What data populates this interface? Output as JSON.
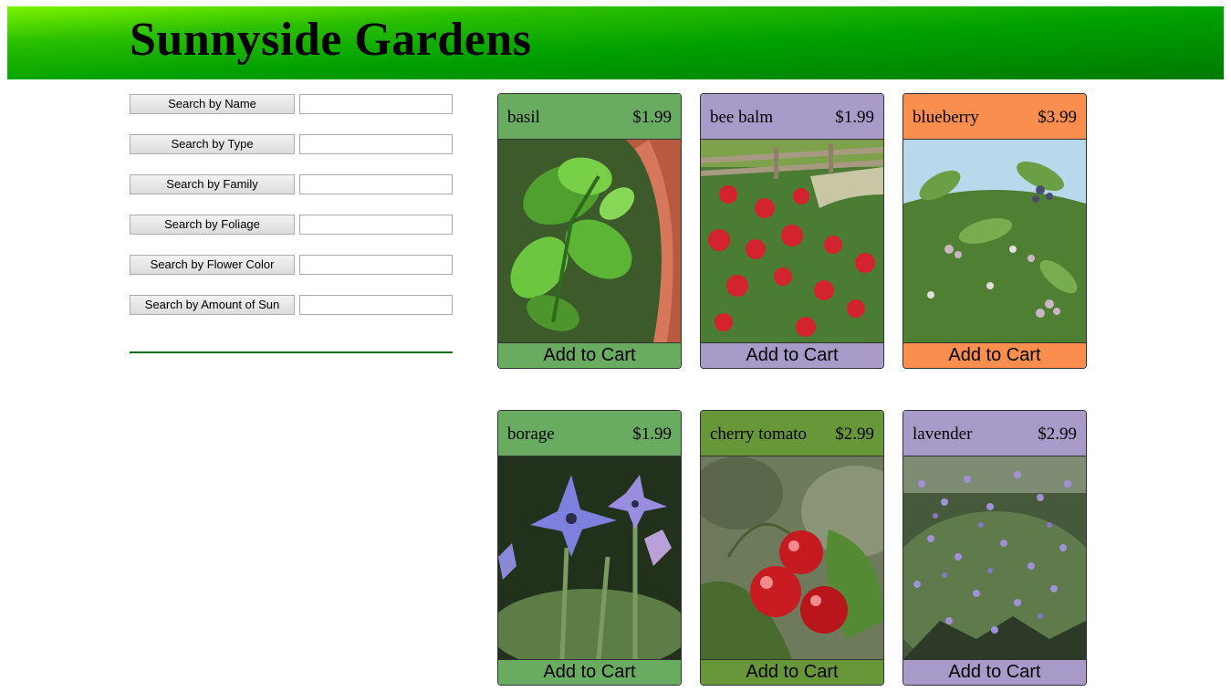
{
  "header": {
    "title": "Sunnyside Gardens"
  },
  "search": [
    {
      "label": "Search by Name",
      "value": ""
    },
    {
      "label": "Search by Type",
      "value": ""
    },
    {
      "label": "Search by Family",
      "value": ""
    },
    {
      "label": "Search by Foliage",
      "value": ""
    },
    {
      "label": "Search by Flower Color",
      "value": ""
    },
    {
      "label": "Search by Amount of Sun",
      "value": ""
    }
  ],
  "products": [
    {
      "name": "basil",
      "price": "$1.99",
      "cart_label": "Add to Cart",
      "color": "#6aab62",
      "image": "basil-photo"
    },
    {
      "name": "bee balm",
      "price": "$1.99",
      "cart_label": "Add to Cart",
      "color": "#a89bc9",
      "image": "bee-balm-photo"
    },
    {
      "name": "blueberry",
      "price": "$3.99",
      "cart_label": "Add to Cart",
      "color": "#f98e4e",
      "image": "blueberry-photo"
    },
    {
      "name": "borage",
      "price": "$1.99",
      "cart_label": "Add to Cart",
      "color": "#6aab62",
      "image": "borage-photo"
    },
    {
      "name": "cherry tomato",
      "price": "$2.99",
      "cart_label": "Add to Cart",
      "color": "#68973a",
      "image": "cherry-tomato-photo"
    },
    {
      "name": "lavender",
      "price": "$2.99",
      "cart_label": "Add to Cart",
      "color": "#a89bc9",
      "image": "lavender-photo"
    }
  ]
}
